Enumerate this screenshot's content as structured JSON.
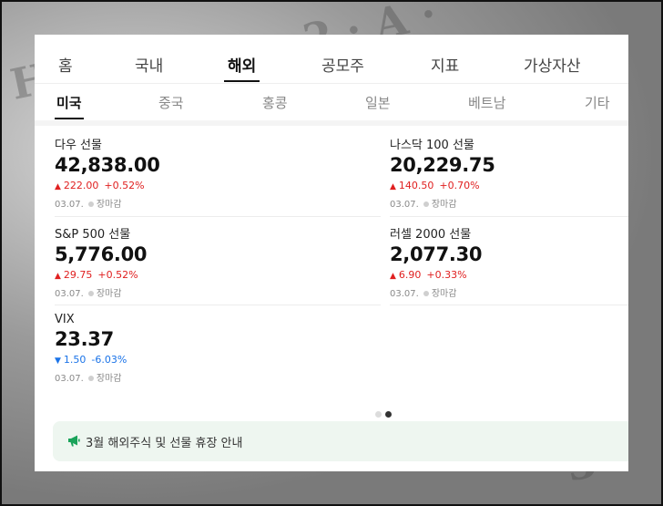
{
  "main_tabs": [
    "홈",
    "국내",
    "해외",
    "공모주",
    "지표",
    "가상자산"
  ],
  "main_tab_active": "해외",
  "sub_tabs": [
    "미국",
    "중국",
    "홍콩",
    "일본",
    "베트남",
    "기타"
  ],
  "sub_tab_active": "미국",
  "indices": [
    {
      "name": "다우 선물",
      "price": "42,838.00",
      "direction": "up",
      "change": "222.00",
      "change_pct": "+0.52%",
      "date": "03.07.",
      "status": "장마감"
    },
    {
      "name": "나스닥 100 선물",
      "price": "20,229.75",
      "direction": "up",
      "change": "140.50",
      "change_pct": "+0.70%",
      "date": "03.07.",
      "status": "장마감"
    },
    {
      "name": "S&P 500 선물",
      "price": "5,776.00",
      "direction": "up",
      "change": "29.75",
      "change_pct": "+0.52%",
      "date": "03.07.",
      "status": "장마감"
    },
    {
      "name": "러셀 2000 선물",
      "price": "2,077.30",
      "direction": "up",
      "change": "6.90",
      "change_pct": "+0.33%",
      "date": "03.07.",
      "status": "장마감"
    },
    {
      "name": "VIX",
      "price": "23.37",
      "direction": "down",
      "change": "1.50",
      "change_pct": "-6.03%",
      "date": "03.07.",
      "status": "장마감"
    }
  ],
  "pager": {
    "total": 2,
    "current": 2
  },
  "notice": {
    "text": "3월 해외주식 및 선물 휴장 안내",
    "icon": "megaphone-icon"
  },
  "colors": {
    "up": "#e02020",
    "down": "#1a73e8",
    "notice_bg": "#eef6f0",
    "notice_icon": "#1aa35a"
  },
  "glyphs": {
    "up": "▲",
    "down": "▼"
  }
}
